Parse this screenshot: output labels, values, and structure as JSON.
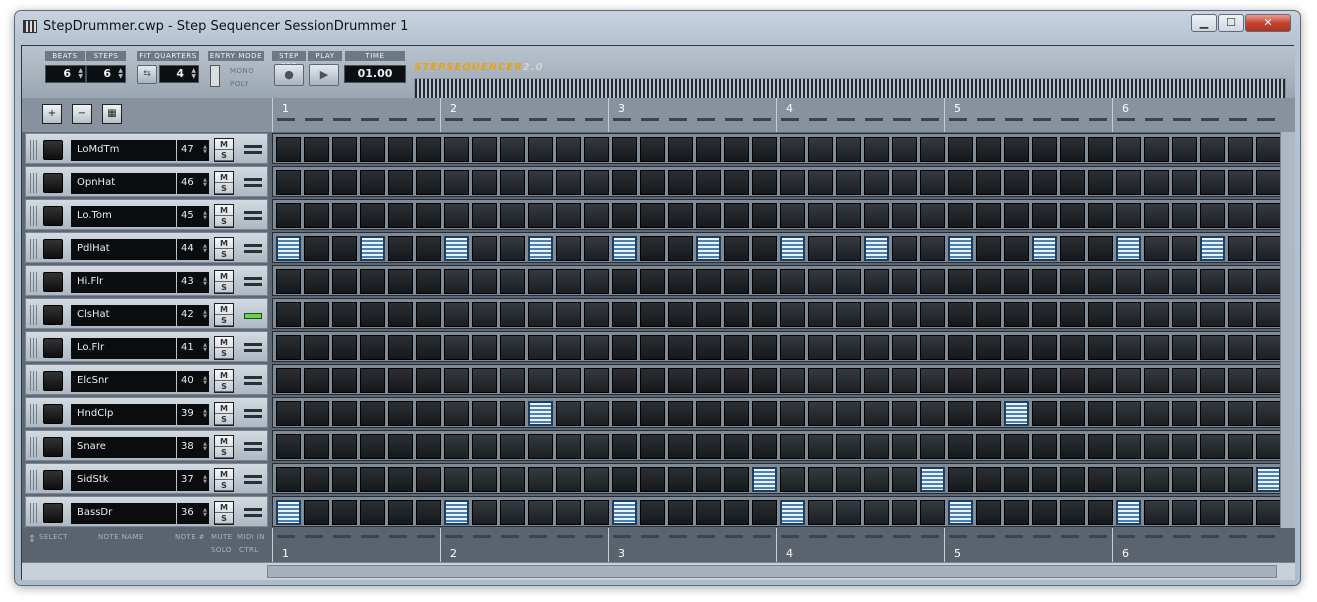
{
  "window": {
    "title": "StepDrummer.cwp - Step Sequencer SessionDrummer 1",
    "min_label": "▁",
    "max_label": "☐",
    "close_label": "✕"
  },
  "toolbar": {
    "beats_label": "BEATS",
    "steps_label": "STEPS",
    "beats_value": "6",
    "steps_value": "6",
    "fit_label": "FIT QUARTERS",
    "fit_value": "4",
    "entry_label": "ENTRY MODE",
    "mono_label": "MONO",
    "poly_label": "POLY",
    "steprec_label": "STEP REC",
    "play_label": "PLAY",
    "time_label": "TIME",
    "time_value": "01.00",
    "logo_a": "STEPSEQUENCER",
    "logo_b": "2.0",
    "rec_glyph": "●",
    "play_glyph": "▶"
  },
  "ruler": {
    "beats": [
      "1",
      "2",
      "3",
      "4",
      "5",
      "6"
    ],
    "add_icon_label": "+",
    "remove_icon_label": "−",
    "grid_icon_label": "▦"
  },
  "footer": {
    "select": "SELECT",
    "note_name": "NOTE NAME",
    "note_num": "NOTE #",
    "mute": "MUTE",
    "solo": "SOLO",
    "midi_in": "MIDI IN",
    "ctrl": "CTRL",
    "arrows": "⇕"
  },
  "colors": {
    "step_on": "#4c7fae",
    "midi_active": "#6ecf4e",
    "logo": "#e8a216"
  },
  "steps_per_row": 36,
  "rows": [
    {
      "name": "LoMdTm",
      "note": "47",
      "m": "M",
      "s": "S",
      "midi_active": false,
      "on": []
    },
    {
      "name": "OpnHat",
      "note": "46",
      "m": "M",
      "s": "S",
      "midi_active": false,
      "on": []
    },
    {
      "name": "Lo.Tom",
      "note": "45",
      "m": "M",
      "s": "S",
      "midi_active": false,
      "on": []
    },
    {
      "name": "PdlHat",
      "note": "44",
      "m": "M",
      "s": "S",
      "midi_active": false,
      "on": [
        0,
        3,
        6,
        9,
        12,
        15,
        18,
        21,
        24,
        27,
        30,
        33
      ]
    },
    {
      "name": "Hi.Flr",
      "note": "43",
      "m": "M",
      "s": "S",
      "midi_active": false,
      "on": []
    },
    {
      "name": "ClsHat",
      "note": "42",
      "m": "M",
      "s": "S",
      "midi_active": true,
      "on": []
    },
    {
      "name": "Lo.Flr",
      "note": "41",
      "m": "M",
      "s": "S",
      "midi_active": false,
      "on": []
    },
    {
      "name": "ElcSnr",
      "note": "40",
      "m": "M",
      "s": "S",
      "midi_active": false,
      "on": []
    },
    {
      "name": "HndClp",
      "note": "39",
      "m": "M",
      "s": "S",
      "midi_active": false,
      "on": [
        9,
        26
      ]
    },
    {
      "name": "Snare",
      "note": "38",
      "m": "M",
      "s": "S",
      "midi_active": false,
      "on": []
    },
    {
      "name": "SidStk",
      "note": "37",
      "m": "M",
      "s": "S",
      "midi_active": false,
      "on": [
        17,
        23,
        35
      ]
    },
    {
      "name": "BassDr",
      "note": "36",
      "m": "M",
      "s": "S",
      "midi_active": false,
      "on": [
        0,
        6,
        12,
        18,
        24,
        30
      ]
    }
  ]
}
